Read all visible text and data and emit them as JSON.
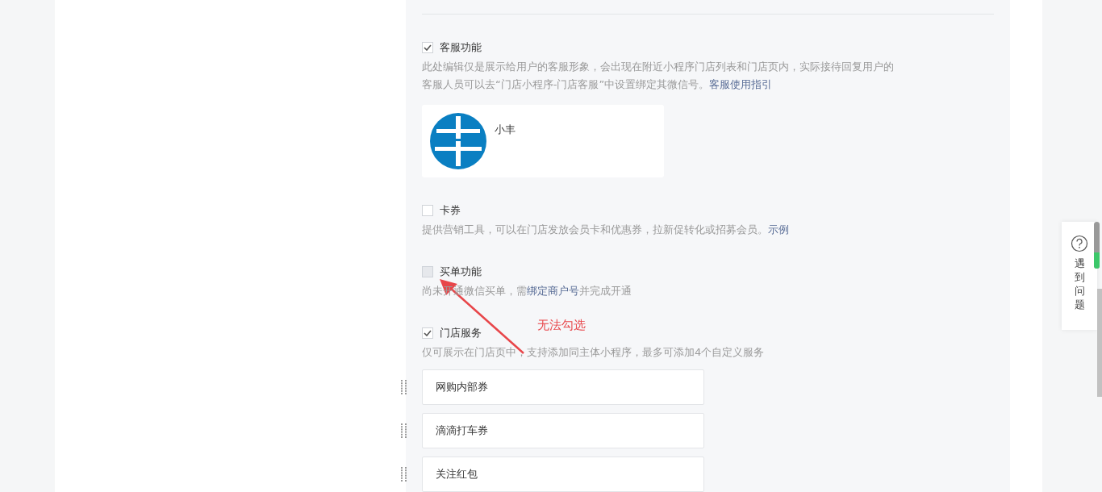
{
  "services": [
    {
      "kind": "agent",
      "label": "客服功能",
      "checked": true,
      "disabled": false,
      "description": "此处编辑仅是展示给用户的客服形象，会出现在附近小程序门店列表和门店页内，实际接待回复用户的客服人员可以去“门店小程序-门店客服”中设置绑定其微信号。",
      "link": "客服使用指引",
      "agent_name": "小丰"
    },
    {
      "kind": "plain",
      "label": "卡券",
      "checked": false,
      "disabled": false,
      "description": "提供营销工具，可以在门店发放会员卡和优惠券，拉新促转化或招募会员。",
      "link": "示例"
    },
    {
      "kind": "plain",
      "label": "买单功能",
      "checked": false,
      "disabled": true,
      "description": "尚未开通微信买单，需",
      "link": "绑定商户号",
      "description_after": "并完成开通"
    },
    {
      "kind": "list",
      "label": "门店服务",
      "checked": true,
      "disabled": false,
      "description": "仅可展示在门店页中，支持添加同主体小程序，最多可添加4个自定义服务",
      "items": [
        "网购内部券",
        "滴滴打车券",
        "关注红包"
      ]
    }
  ],
  "annotation": "无法勾选",
  "help": {
    "label": "遇到问题"
  }
}
